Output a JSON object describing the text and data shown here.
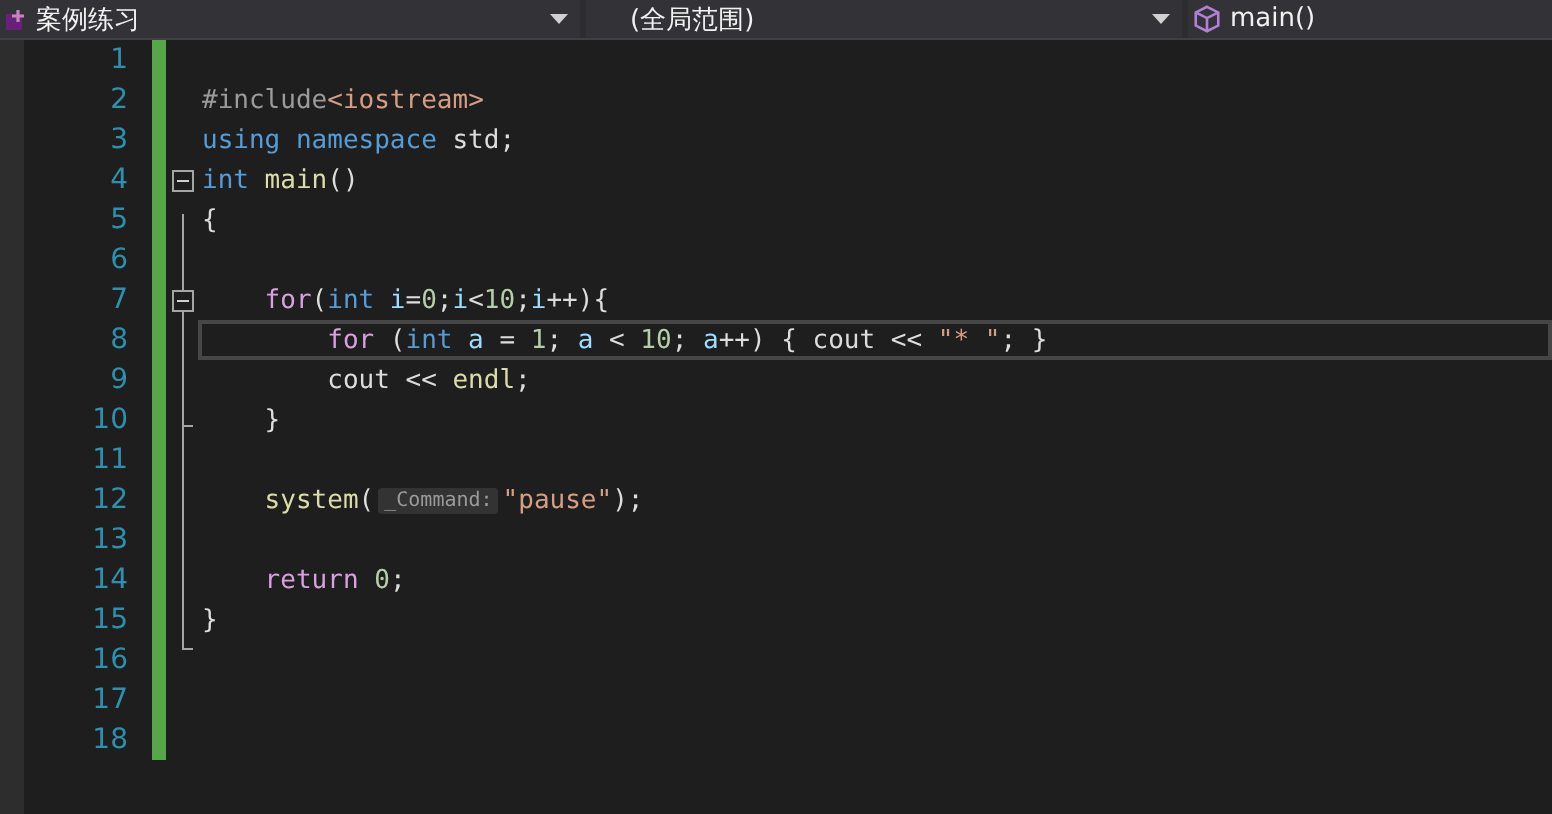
{
  "toolbar": {
    "dropdowns": [
      {
        "kind": "project",
        "label": "案例练习"
      },
      {
        "kind": "scope",
        "label": "(全局范围)"
      },
      {
        "kind": "member",
        "label": "main()"
      }
    ]
  },
  "editor": {
    "lines": [
      {
        "number": "1",
        "changed": true,
        "current": false
      },
      {
        "number": "2",
        "changed": true,
        "current": false,
        "tokens": [
          {
            "kind": "preproc",
            "text": "#include"
          },
          {
            "kind": "include",
            "text": "<iostream>"
          }
        ]
      },
      {
        "number": "3",
        "changed": true,
        "current": false,
        "tokens": [
          {
            "kind": "keyword",
            "text": "using namespace"
          },
          {
            "kind": "plain",
            "text": " std;"
          }
        ]
      },
      {
        "number": "4",
        "changed": true,
        "expanded": true,
        "current": false,
        "tokens": [
          {
            "kind": "keyword",
            "text": "int"
          },
          {
            "kind": "func",
            "text": " main"
          },
          {
            "kind": "plain",
            "text": "()"
          }
        ]
      },
      {
        "number": "5",
        "changed": true,
        "current": false,
        "tokens": [
          {
            "kind": "plain",
            "text": "{"
          }
        ]
      },
      {
        "number": "6",
        "changed": true,
        "current": false
      },
      {
        "number": "7",
        "changed": true,
        "expanded": true,
        "current": false,
        "tokens": [
          {
            "kind": "control",
            "text": "    for"
          },
          {
            "kind": "plain",
            "text": "("
          },
          {
            "kind": "keyword",
            "text": "int"
          },
          {
            "kind": "var",
            "text": " i"
          },
          {
            "kind": "plain",
            "text": "="
          },
          {
            "kind": "number",
            "text": "0"
          },
          {
            "kind": "plain",
            "text": ";"
          },
          {
            "kind": "var",
            "text": "i"
          },
          {
            "kind": "plain",
            "text": "<"
          },
          {
            "kind": "number",
            "text": "10"
          },
          {
            "kind": "plain",
            "text": ";"
          },
          {
            "kind": "var",
            "text": "i"
          },
          {
            "kind": "plain",
            "text": "++){"
          }
        ]
      },
      {
        "number": "8",
        "changed": true,
        "current": true,
        "tokens": [
          {
            "kind": "control",
            "text": "        for"
          },
          {
            "kind": "plain",
            "text": " ("
          },
          {
            "kind": "keyword",
            "text": "int"
          },
          {
            "kind": "var",
            "text": " a"
          },
          {
            "kind": "plain",
            "text": " = "
          },
          {
            "kind": "number",
            "text": "1"
          },
          {
            "kind": "plain",
            "text": "; "
          },
          {
            "kind": "var",
            "text": "a"
          },
          {
            "kind": "plain",
            "text": " < "
          },
          {
            "kind": "number",
            "text": "10"
          },
          {
            "kind": "plain",
            "text": "; "
          },
          {
            "kind": "var",
            "text": "a"
          },
          {
            "kind": "plain",
            "text": "++) { cout << "
          },
          {
            "kind": "string",
            "text": "\"* \""
          },
          {
            "kind": "plain",
            "text": "; }"
          }
        ]
      },
      {
        "number": "9",
        "changed": true,
        "current": false,
        "tokens": [
          {
            "kind": "plain",
            "text": "        cout << "
          },
          {
            "kind": "func",
            "text": "endl"
          },
          {
            "kind": "plain",
            "text": ";"
          }
        ]
      },
      {
        "number": "10",
        "changed": true,
        "current": false,
        "tokens": [
          {
            "kind": "plain",
            "text": "    }"
          }
        ]
      },
      {
        "number": "11",
        "changed": true,
        "current": false
      },
      {
        "number": "12",
        "changed": true,
        "current": false,
        "tokens": [
          {
            "kind": "func",
            "text": "    system"
          },
          {
            "kind": "plain",
            "text": "("
          },
          {
            "kind": "hint",
            "text": "_Command:"
          },
          {
            "kind": "string",
            "text": "\"pause\""
          },
          {
            "kind": "plain",
            "text": ");"
          }
        ]
      },
      {
        "number": "13",
        "changed": true,
        "current": false
      },
      {
        "number": "14",
        "changed": true,
        "current": false,
        "tokens": [
          {
            "kind": "control",
            "text": "    return"
          },
          {
            "kind": "number",
            "text": " 0"
          },
          {
            "kind": "plain",
            "text": ";"
          }
        ]
      },
      {
        "number": "15",
        "changed": true,
        "current": false,
        "tokens": [
          {
            "kind": "plain",
            "text": "}"
          }
        ]
      },
      {
        "number": "16",
        "changed": true,
        "current": false
      },
      {
        "number": "17",
        "changed": true,
        "current": false
      },
      {
        "number": "18",
        "changed": true,
        "current": false
      }
    ]
  }
}
